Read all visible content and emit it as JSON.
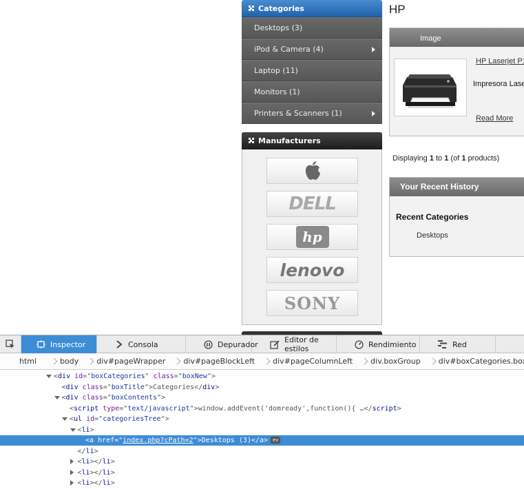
{
  "categories": {
    "title": "Categories",
    "items": [
      {
        "label": "Desktops (3)",
        "has_sub": false
      },
      {
        "label": "iPod & Camera (4)",
        "has_sub": true
      },
      {
        "label": "Laptop (11)",
        "has_sub": false
      },
      {
        "label": "Monitors (1)",
        "has_sub": false
      },
      {
        "label": "Printers & Scanners (1)",
        "has_sub": true
      }
    ]
  },
  "manufacturers": {
    "title": "Manufacturers",
    "logos": [
      "apple-logo",
      "dell-logo",
      "hp-logo",
      "lenovo-logo",
      "sony-logo"
    ],
    "logo_text": {
      "dell": "DELL",
      "hp": "hp",
      "lenovo": "lenovo",
      "sony": "SONY"
    }
  },
  "main": {
    "heading": "HP",
    "product_header": "Image",
    "product_link": "HP Laserjet P1",
    "product_desc": "Impresora Lase",
    "read_more": "Read More",
    "displaying": {
      "prefix": "Displaying ",
      "from": "1",
      "mid": " to ",
      "to": "1",
      "pre_total": " (of ",
      "total": "1",
      "suffix": " products)"
    },
    "recent": {
      "title": "Your Recent History",
      "categories_title": "Recent Categories",
      "item": "Desktops"
    }
  },
  "devtools": {
    "tabs": [
      {
        "label": "Inspector",
        "icon": "inspector-icon",
        "active": true
      },
      {
        "label": "Consola",
        "icon": "console-icon",
        "active": false
      },
      {
        "label": "Depurador",
        "icon": "debugger-icon",
        "active": false
      },
      {
        "label": "Editor de estilos",
        "icon": "style-editor-icon",
        "active": false
      },
      {
        "label": "Rendimiento",
        "icon": "performance-icon",
        "active": false
      },
      {
        "label": "Red",
        "icon": "network-icon",
        "active": false
      }
    ],
    "breadcrumbs": [
      "html",
      "body",
      "div#pageWrapper",
      "div#pageBlockLeft",
      "div#pageColumnLeft",
      "div.boxGroup",
      "div#boxCategories.boxNew"
    ],
    "markup_lines": [
      {
        "depth": 0,
        "twisty": "open",
        "parts": [
          [
            "p",
            "<"
          ],
          [
            "t",
            "div"
          ],
          [
            "p",
            " "
          ],
          [
            "a",
            "id"
          ],
          [
            "p",
            "=\""
          ],
          [
            "v",
            "boxCategories"
          ],
          [
            "p",
            "\" "
          ],
          [
            "a",
            "class"
          ],
          [
            "p",
            "=\""
          ],
          [
            "v",
            "boxNew"
          ],
          [
            "p",
            "\">"
          ]
        ]
      },
      {
        "depth": 1,
        "twisty": "",
        "parts": [
          [
            "p",
            "<"
          ],
          [
            "t",
            "div"
          ],
          [
            "p",
            " "
          ],
          [
            "a",
            "class"
          ],
          [
            "p",
            "=\""
          ],
          [
            "v",
            "boxTitle"
          ],
          [
            "p",
            "\">"
          ],
          [
            "p",
            "Categories"
          ],
          [
            "p",
            "</"
          ],
          [
            "t",
            "div"
          ],
          [
            "p",
            ">"
          ]
        ]
      },
      {
        "depth": 1,
        "twisty": "open",
        "parts": [
          [
            "p",
            "<"
          ],
          [
            "t",
            "div"
          ],
          [
            "p",
            " "
          ],
          [
            "a",
            "class"
          ],
          [
            "p",
            "=\""
          ],
          [
            "v",
            "boxContents"
          ],
          [
            "p",
            "\">"
          ]
        ]
      },
      {
        "depth": 2,
        "twisty": "",
        "parts": [
          [
            "p",
            "<"
          ],
          [
            "t",
            "script"
          ],
          [
            "p",
            " "
          ],
          [
            "a",
            "type"
          ],
          [
            "p",
            "=\""
          ],
          [
            "v",
            "text/javascript"
          ],
          [
            "p",
            "\">"
          ],
          [
            "p",
            "window.addEvent('domready',function(){ …"
          ],
          [
            "p",
            "</"
          ],
          [
            "t",
            "script"
          ],
          [
            "p",
            ">"
          ]
        ]
      },
      {
        "depth": 2,
        "twisty": "open",
        "parts": [
          [
            "p",
            "<"
          ],
          [
            "t",
            "ul"
          ],
          [
            "p",
            " "
          ],
          [
            "a",
            "id"
          ],
          [
            "p",
            "=\""
          ],
          [
            "v",
            "categoriesTree"
          ],
          [
            "p",
            "\">"
          ]
        ]
      },
      {
        "depth": 3,
        "twisty": "open",
        "parts": [
          [
            "p",
            "<"
          ],
          [
            "t",
            "li"
          ],
          [
            "p",
            ">"
          ]
        ]
      },
      {
        "depth": 4,
        "twisty": "",
        "selected": true,
        "parts": [
          [
            "p",
            "<"
          ],
          [
            "t",
            "a"
          ],
          [
            "p",
            " "
          ],
          [
            "a",
            "href"
          ],
          [
            "p",
            "=\""
          ],
          [
            "v",
            "index.php?cPath=2"
          ],
          [
            "p",
            "\">"
          ],
          [
            "p",
            "Desktops (3)"
          ],
          [
            "p",
            "</"
          ],
          [
            "t",
            "a"
          ],
          [
            "p",
            ">"
          ]
        ],
        "badge": "ev"
      },
      {
        "depth": 3,
        "twisty": "",
        "parts": [
          [
            "p",
            "</"
          ],
          [
            "t",
            "li"
          ],
          [
            "p",
            ">"
          ]
        ]
      },
      {
        "depth": 3,
        "twisty": "closed",
        "parts": [
          [
            "p",
            "<"
          ],
          [
            "t",
            "li"
          ],
          [
            "p",
            "></"
          ],
          [
            "t",
            "li"
          ],
          [
            "p",
            ">"
          ]
        ]
      },
      {
        "depth": 3,
        "twisty": "closed",
        "parts": [
          [
            "p",
            "<"
          ],
          [
            "t",
            "li"
          ],
          [
            "p",
            "></"
          ],
          [
            "t",
            "li"
          ],
          [
            "p",
            ">"
          ]
        ]
      },
      {
        "depth": 3,
        "twisty": "closed",
        "parts": [
          [
            "p",
            "<"
          ],
          [
            "t",
            "li"
          ],
          [
            "p",
            "></"
          ],
          [
            "t",
            "li"
          ],
          [
            "p",
            ">"
          ]
        ]
      },
      {
        "depth": 3,
        "twisty": "closed",
        "parts": [
          [
            "p",
            "<"
          ],
          [
            "t",
            "li"
          ],
          [
            "p",
            "></"
          ],
          [
            "t",
            "li"
          ],
          [
            "p",
            ">"
          ]
        ]
      }
    ]
  }
}
